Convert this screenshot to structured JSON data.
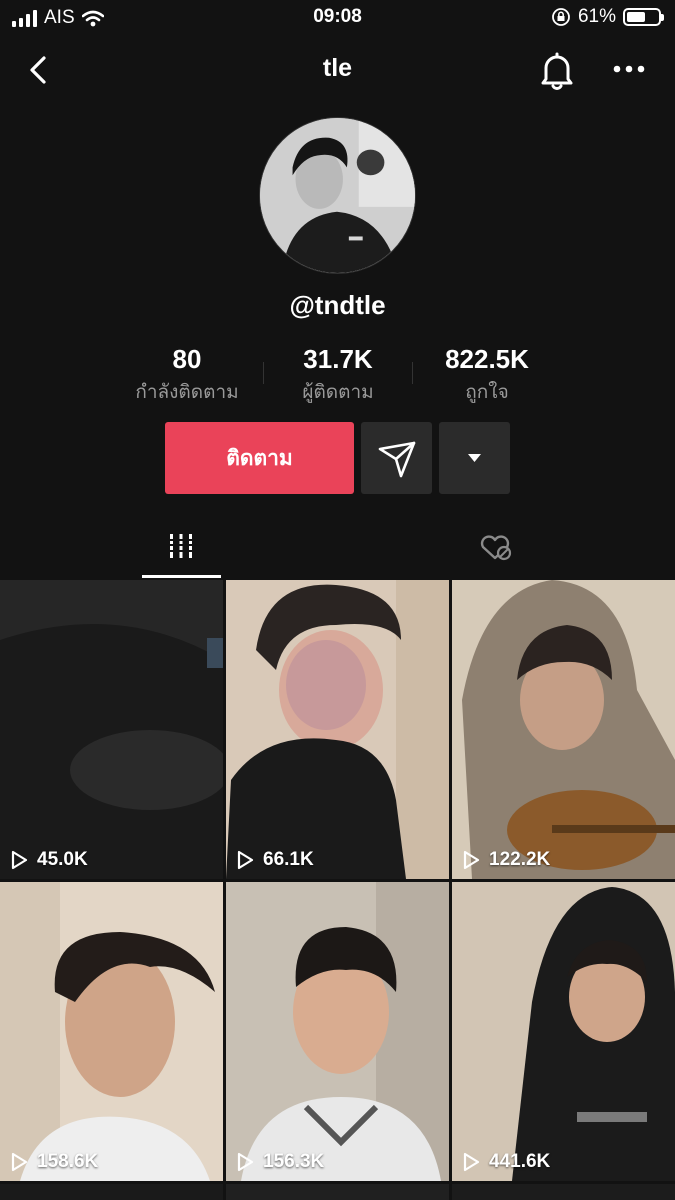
{
  "status_bar": {
    "carrier": "AIS",
    "time": "09:08",
    "battery": "61%",
    "battery_level": 0.61
  },
  "header": {
    "title": "tle"
  },
  "profile": {
    "username": "@tndtle",
    "stats": [
      {
        "value": "80",
        "label": "กำลังติดตาม"
      },
      {
        "value": "31.7K",
        "label": "ผู้ติดตาม"
      },
      {
        "value": "822.5K",
        "label": "ถูกใจ"
      }
    ],
    "follow_label": "ติดตาม"
  },
  "tabs": [
    {
      "name": "videos",
      "icon": "grid-icon",
      "active": true
    },
    {
      "name": "liked",
      "icon": "hidden-liked-icon",
      "active": false
    }
  ],
  "videos": [
    {
      "views": "45.0K"
    },
    {
      "views": "66.1K"
    },
    {
      "views": "122.2K"
    },
    {
      "views": "158.6K"
    },
    {
      "views": "156.3K"
    },
    {
      "views": "441.6K"
    }
  ],
  "colors": {
    "accent": "#ea4359",
    "background": "#121212",
    "button_dark": "#2b2b2b"
  }
}
